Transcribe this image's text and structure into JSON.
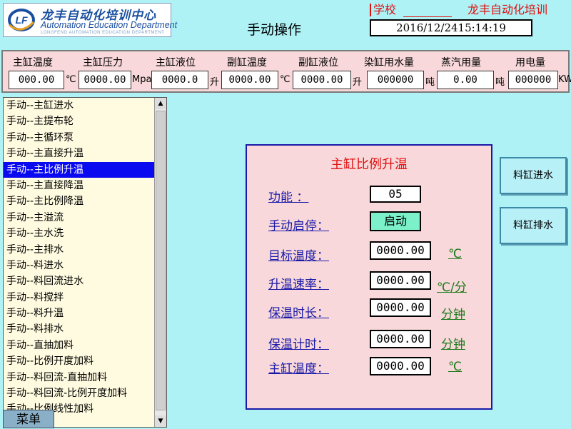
{
  "header": {
    "logo": {
      "mark": "LF",
      "cn": "龙丰自动化培训中心",
      "en": "Automation Education Department",
      "tiny": "LONGFENG AUTOMATION EDUCATION DEPARTMENT"
    },
    "title": "手动操作",
    "school_label": "学校",
    "company": "龙丰自动化培训",
    "datetime": "2016/12/2415:14:19"
  },
  "status": [
    {
      "label": "主缸温度",
      "value": "000.00",
      "unit": "℃"
    },
    {
      "label": "主缸压力",
      "value": "0000.00",
      "unit": "Mpa"
    },
    {
      "label": "主缸液位",
      "value": "0000.0",
      "unit": "升"
    },
    {
      "label": "副缸温度",
      "value": "0000.00",
      "unit": "℃"
    },
    {
      "label": "副缸液位",
      "value": "0000.00",
      "unit": "升"
    },
    {
      "label": "染缸用水量",
      "value": "000000",
      "unit": "吨"
    },
    {
      "label": "蒸汽用量",
      "value": "0.00",
      "unit": "吨"
    },
    {
      "label": "用电量",
      "value": "000000",
      "unit": "KW"
    }
  ],
  "list": {
    "items": [
      "手动--主缸进水",
      "手动--主提布轮",
      "手动--主循环泵",
      "手动--主直接升温",
      "手动--主比例升温",
      "手动--主直接降温",
      "手动--主比例降温",
      "手动--主溢流",
      "手动--主水洗",
      "手动--主排水",
      "手动--料进水",
      "手动--料回流进水",
      "手动--料搅拌",
      "手动--料升温",
      "手动--料排水",
      "手动--直抽加料",
      "手动--比例开度加料",
      "手动--料回流-直抽加料",
      "手动--料回流-比例开度加料",
      "手动--比例线性加料"
    ],
    "selected_index": 4
  },
  "menu_label": "菜单",
  "panel": {
    "title": "主缸比例升温",
    "function_label": "功能 ：",
    "function_value": "05",
    "startstop_label": "手动启停：",
    "startstop_value": "启动",
    "rows": [
      {
        "label": "目标温度：",
        "value": "0000.00",
        "unit": "℃"
      },
      {
        "label": "升温速率：",
        "value": "0000.00",
        "unit": "℃/分"
      },
      {
        "label": "保温时长：",
        "value": "0000.00",
        "unit": "分钟"
      },
      {
        "label": "保温计时：",
        "value": "0000.00",
        "unit": "分钟"
      },
      {
        "label": "主缸温度：",
        "value": "0000.00",
        "unit": "℃"
      }
    ]
  },
  "right_buttons": {
    "fill": "料缸进水",
    "drain": "料缸排水"
  },
  "icons": {
    "scroll_up": "triangle-up-icon",
    "scroll_down": "triangle-down-icon"
  }
}
